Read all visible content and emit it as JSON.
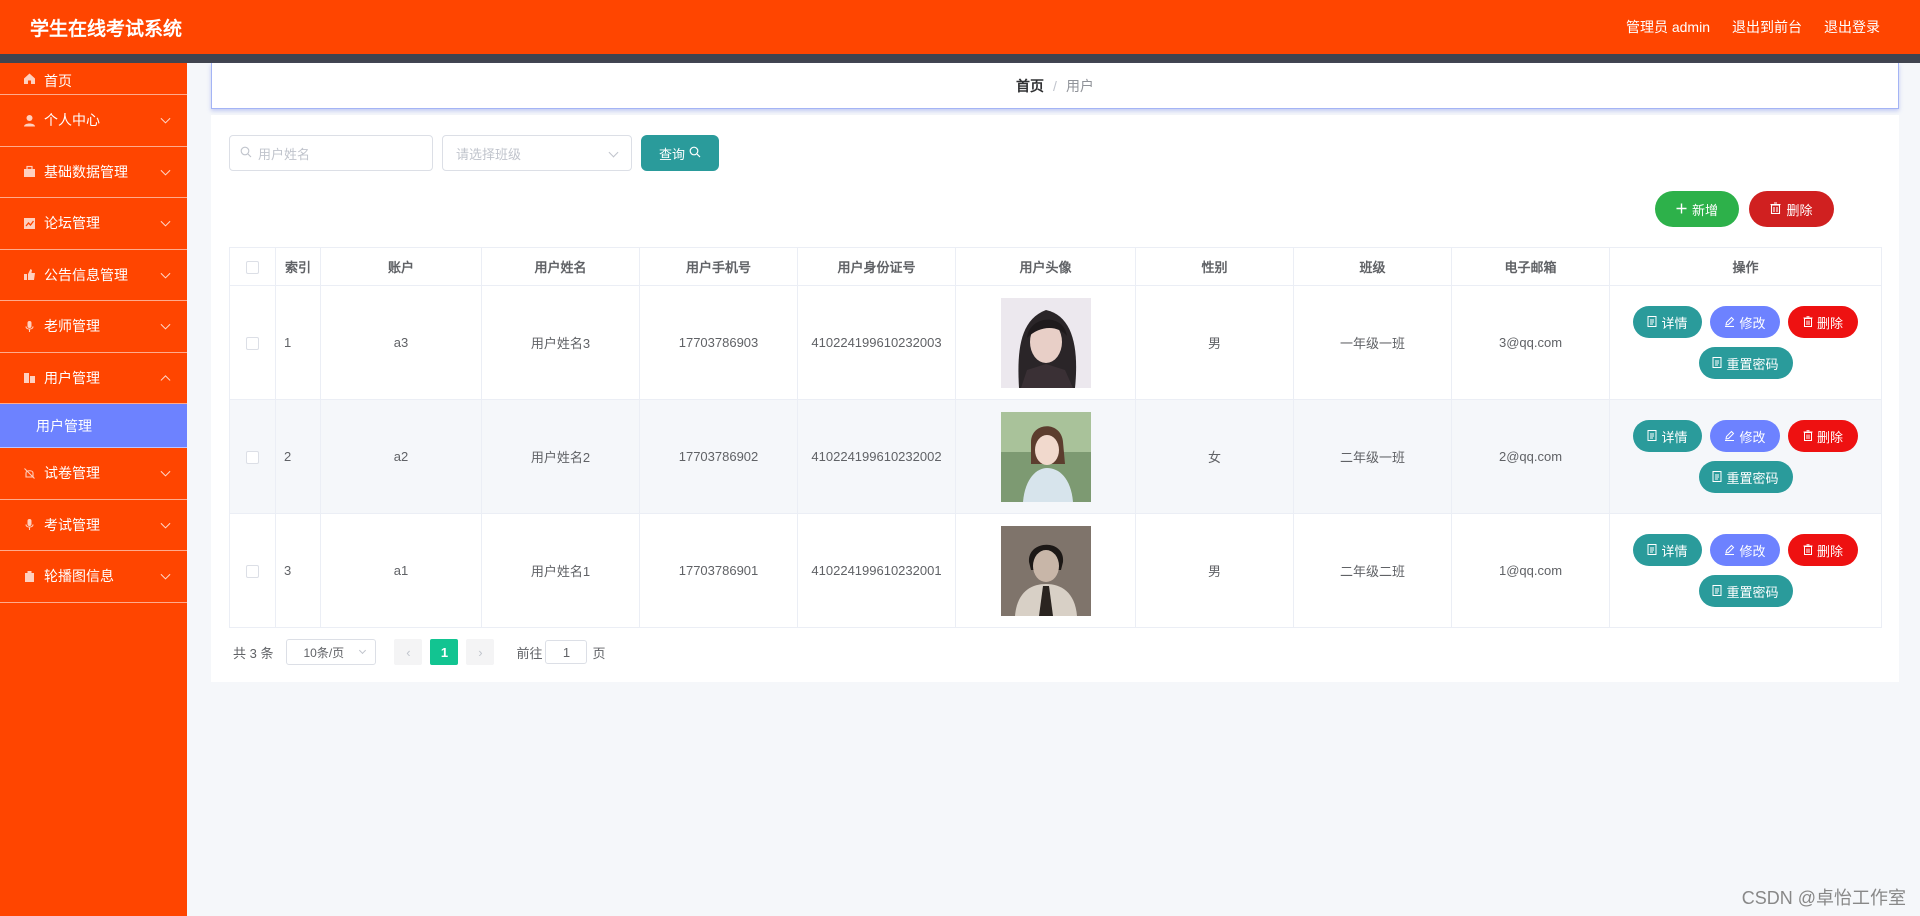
{
  "header": {
    "app_title": "学生在线考试系统",
    "admin_label": "管理员 admin",
    "to_front_label": "退出到前台",
    "logout_label": "退出登录"
  },
  "sidebar": {
    "items": [
      {
        "label": "首页",
        "icon": "home-icon"
      },
      {
        "label": "个人中心",
        "icon": "user-icon"
      },
      {
        "label": "基础数据管理",
        "icon": "briefcase-icon"
      },
      {
        "label": "论坛管理",
        "icon": "chart-icon"
      },
      {
        "label": "公告信息管理",
        "icon": "thumb-icon"
      },
      {
        "label": "老师管理",
        "icon": "mic-icon"
      },
      {
        "label": "用户管理",
        "icon": "building-icon"
      },
      {
        "label": "试卷管理",
        "icon": "bell-off-icon"
      },
      {
        "label": "考试管理",
        "icon": "mic-icon"
      },
      {
        "label": "轮播图信息",
        "icon": "trash-icon"
      }
    ],
    "active_sub": "用户管理"
  },
  "breadcrumb": {
    "home": "首页",
    "sep": "/",
    "current": "用户"
  },
  "filters": {
    "name_placeholder": "用户姓名",
    "class_placeholder": "请选择班级",
    "query_label": "查询"
  },
  "actions": {
    "add_label": "新增",
    "delete_label": "删除"
  },
  "table": {
    "headers": [
      "索引",
      "账户",
      "用户姓名",
      "用户手机号",
      "用户身份证号",
      "用户头像",
      "性别",
      "班级",
      "电子邮箱",
      "操作"
    ],
    "rows": [
      {
        "index": "1",
        "account": "a3",
        "name": "用户姓名3",
        "phone": "17703786903",
        "id_card": "410224199610232003",
        "gender": "男",
        "class": "一年级一班",
        "email": "3@qq.com"
      },
      {
        "index": "2",
        "account": "a2",
        "name": "用户姓名2",
        "phone": "17703786902",
        "id_card": "410224199610232002",
        "gender": "女",
        "class": "二年级一班",
        "email": "2@qq.com"
      },
      {
        "index": "3",
        "account": "a1",
        "name": "用户姓名1",
        "phone": "17703786901",
        "id_card": "410224199610232001",
        "gender": "男",
        "class": "二年级二班",
        "email": "1@qq.com"
      }
    ],
    "op_labels": {
      "detail": "详情",
      "edit": "修改",
      "remove": "删除",
      "reset": "重置密码"
    }
  },
  "pagination": {
    "total": "共 3 条",
    "page_size": "10条/页",
    "current_page": "1",
    "goto_label": "前往",
    "goto_value": "1",
    "page_suffix": "页"
  },
  "watermark": "CSDN @卓怡工作室",
  "colors": {
    "primary": "#ff4500",
    "accent": "#6d82ff",
    "teal": "#2a9b9b",
    "green": "#2db14a",
    "red": "#d02020"
  }
}
